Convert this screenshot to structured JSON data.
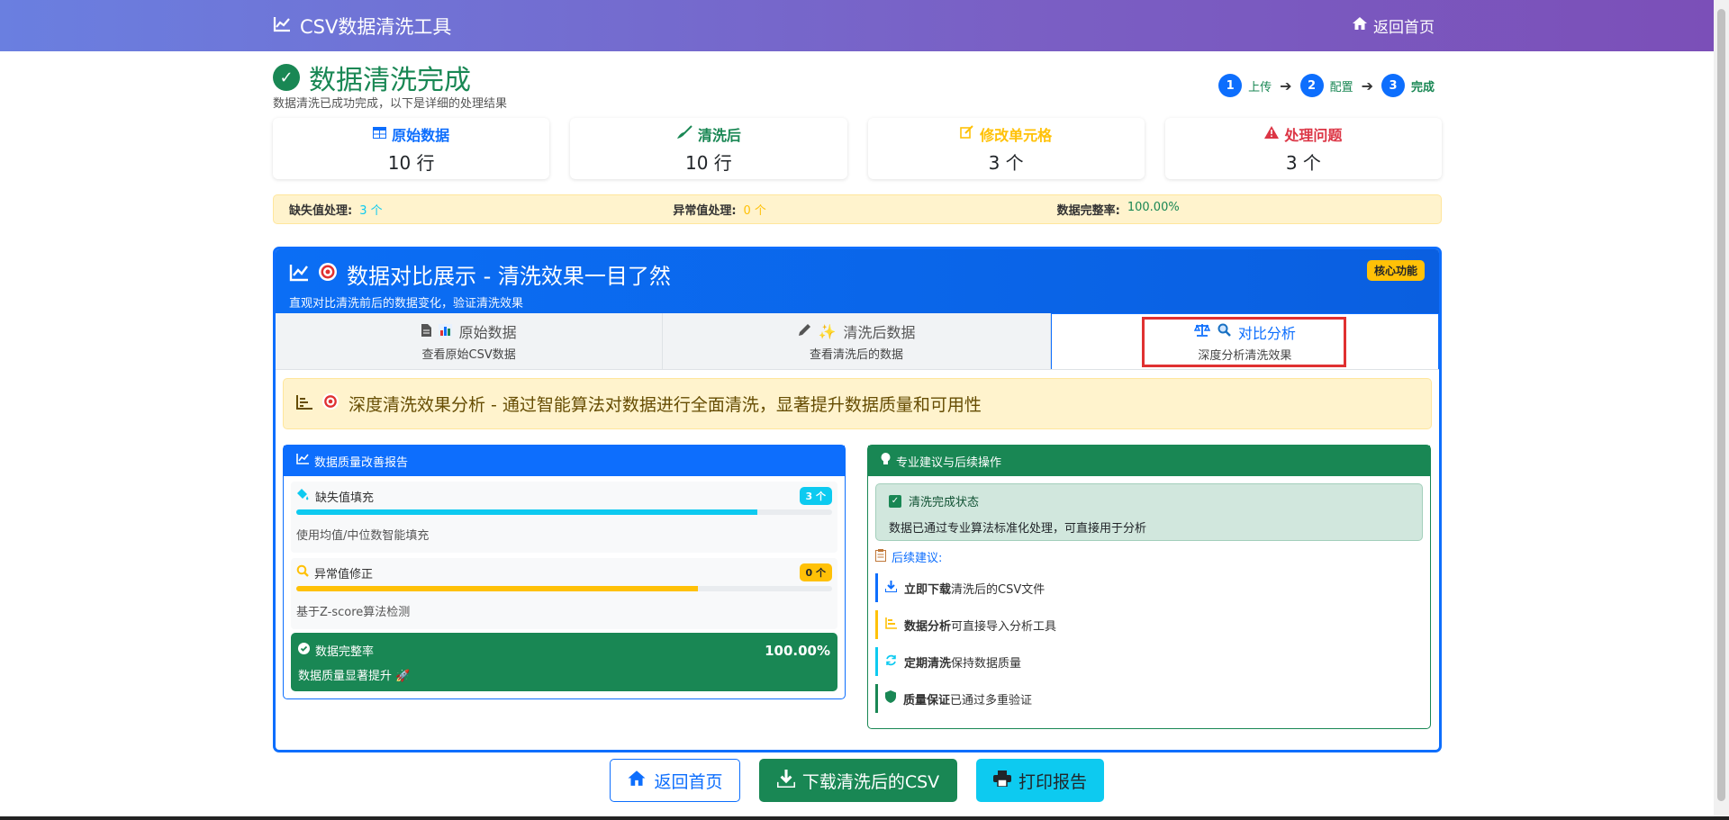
{
  "navbar": {
    "brand": "CSV数据清洗工具",
    "home_link": "返回首页"
  },
  "header": {
    "title": "数据清洗完成",
    "subtitle": "数据清洗已成功完成，以下是详细的处理结果"
  },
  "steps": [
    {
      "num": "1",
      "label": "上传"
    },
    {
      "num": "2",
      "label": "配置"
    },
    {
      "num": "3",
      "label": "完成"
    }
  ],
  "stats": [
    {
      "title": "原始数据",
      "value": "10 行",
      "color": "#0d6efd",
      "icon": "table-icon"
    },
    {
      "title": "清洗后",
      "value": "10 行",
      "color": "#198754",
      "icon": "broom-icon"
    },
    {
      "title": "修改单元格",
      "value": "3 个",
      "color": "#ffc107",
      "icon": "edit-icon"
    },
    {
      "title": "处理问题",
      "value": "3 个",
      "color": "#dc3545",
      "icon": "warning-icon"
    }
  ],
  "infobar": {
    "missing_label": "缺失值处理:",
    "missing_value": "3 个",
    "outlier_label": "异常值处理:",
    "outlier_value": "0 个",
    "complete_label": "数据完整率:",
    "complete_value": "100.00%"
  },
  "panel": {
    "title": "数据对比展示 - 清洗效果一目了然",
    "subtitle": "直观对比清洗前后的数据变化，验证清洗效果",
    "badge": "核心功能"
  },
  "tabs": [
    {
      "title": "原始数据",
      "sub": "查看原始CSV数据"
    },
    {
      "title": "清洗后数据",
      "sub": "查看清洗后的数据"
    },
    {
      "title": "对比分析",
      "sub": "深度分析清洗效果"
    }
  ],
  "analysis_alert": "深度清洗效果分析 - 通过智能算法对数据进行全面清洗，显著提升数据质量和可用性",
  "quality_report": {
    "title": "数据质量改善报告",
    "items": [
      {
        "name": "缺失值填充",
        "count": "3 个",
        "desc": "使用均值/中位数智能填充",
        "progress": 0.86
      },
      {
        "name": "异常值修正",
        "count": "0 个",
        "desc": "基于Z-score算法检测",
        "progress": 0.75
      }
    ],
    "completeness": {
      "label": "数据完整率",
      "value": "100.00%",
      "sub": "数据质量显著提升 🚀"
    }
  },
  "suggestions": {
    "title": "专业建议与后续操作",
    "status_title": "清洗完成状态",
    "status_desc": "数据已通过专业算法标准化处理，可直接用于分析",
    "followup": "后续建议:",
    "items": [
      {
        "bold": "立即下载",
        "rest": "清洗后的CSV文件",
        "color": "#0d6efd"
      },
      {
        "bold": "数据分析",
        "rest": "可直接导入分析工具",
        "color": "#ffc107"
      },
      {
        "bold": "定期清洗",
        "rest": "保持数据质量",
        "color": "#0dcaf0"
      },
      {
        "bold": "质量保证",
        "rest": "已通过多重验证",
        "color": "#198754"
      }
    ]
  },
  "buttons": {
    "home": "返回首页",
    "download": "下载清洗后的CSV",
    "print": "打印报告"
  }
}
